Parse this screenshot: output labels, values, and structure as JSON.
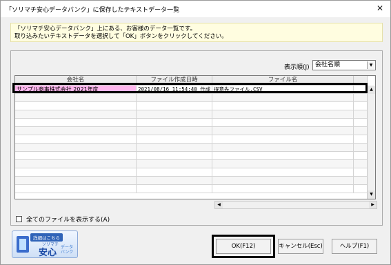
{
  "window": {
    "title": "「ソリマチ安心データバンク」に保存したテキストデータ一覧",
    "close_glyph": "✕"
  },
  "notice": {
    "line1": "「ソリマチ安心データバンク」上にある、お客様のデータ一覧です。",
    "line2": "取り込みたいテキストデータを選択して「OK」ボタンをクリックしてください。"
  },
  "sort": {
    "label": "表示順(J)",
    "value": "会社名順"
  },
  "grid": {
    "columns": [
      "会社名",
      "ファイル作成日時",
      "ファイル名"
    ],
    "rows": [
      {
        "company": "サンプル商事株式会社 2021年度",
        "created": "2021/08/16 11:54:40 作成",
        "filename": "得意先ファイル.CSV"
      }
    ]
  },
  "show_all": {
    "label": "全てのファイルを表示する(A)"
  },
  "logo": {
    "badge": "詳細はこちら",
    "brand": "ソリマチ",
    "name": "安心",
    "sub": "データバンク"
  },
  "buttons": {
    "ok": "OK(F12)",
    "cancel": "キャンセル(Esc)",
    "help": "ヘルプ(F1)"
  }
}
